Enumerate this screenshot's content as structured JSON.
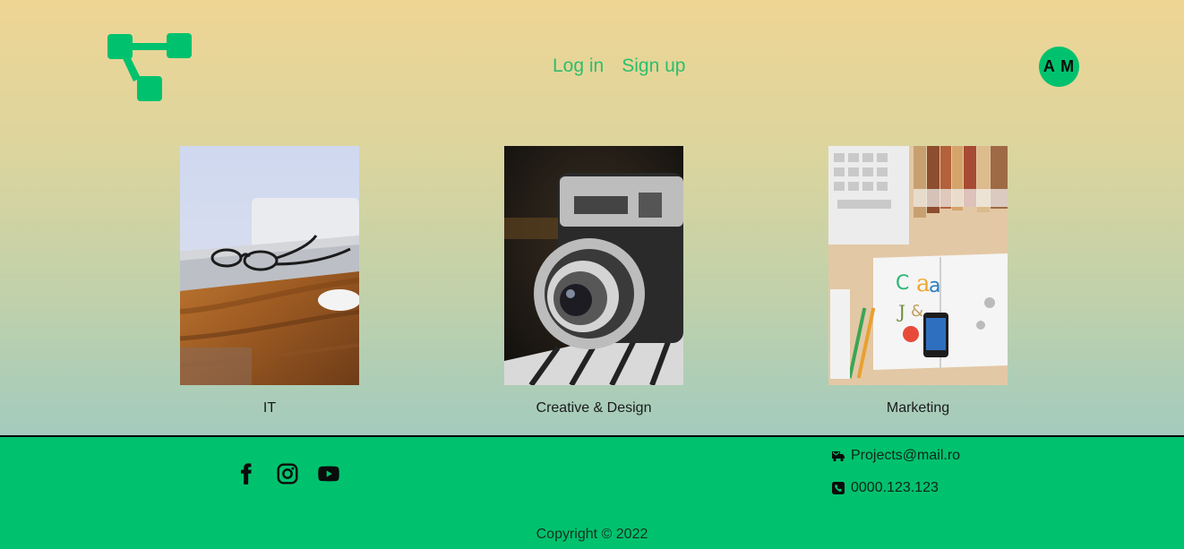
{
  "header": {
    "logo_icon": "network-nodes-icon",
    "nav": {
      "login_label": "Log in",
      "signup_label": "Sign up"
    },
    "avatar_initials": "A M"
  },
  "categories": [
    {
      "label": "IT",
      "image": "laptop-glasses-photo"
    },
    {
      "label": "Creative & Design",
      "image": "vintage-camera-photo"
    },
    {
      "label": "Marketing",
      "image": "desk-flatlay-photo"
    }
  ],
  "footer": {
    "socials": [
      "facebook-icon",
      "instagram-icon",
      "youtube-icon"
    ],
    "email": "Projects@mail.ro",
    "phone": "0000.123.123",
    "copyright": "Copyright © 2022"
  },
  "colors": {
    "accent": "#00c26e",
    "nav_link": "#2bbf6e",
    "gradient_top": "#eed594",
    "gradient_bottom": "#a3cbbd"
  }
}
